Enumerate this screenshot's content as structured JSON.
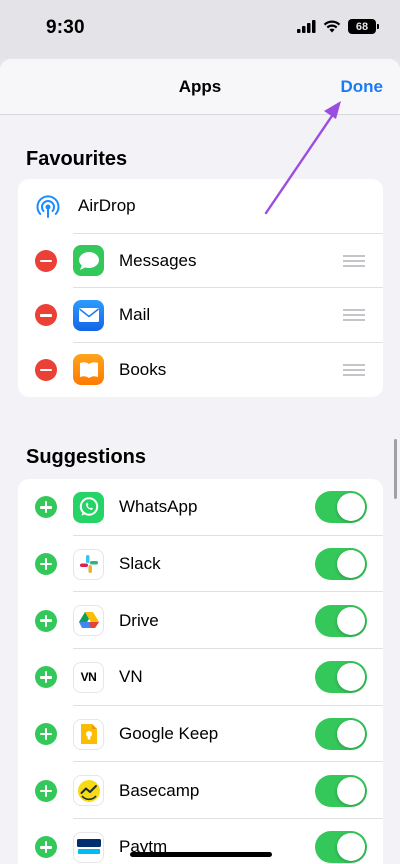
{
  "status_bar": {
    "time": "9:30",
    "battery": "68",
    "icons": [
      "cellular-signal-icon",
      "wifi-icon",
      "battery-icon"
    ]
  },
  "nav": {
    "title": "Apps",
    "done_label": "Done"
  },
  "favourites": {
    "header": "Favourites",
    "airdrop": {
      "label": "AirDrop",
      "icon": "airdrop-icon"
    },
    "items": [
      {
        "label": "Messages",
        "icon": "messages-icon",
        "color": "#34c759"
      },
      {
        "label": "Mail",
        "icon": "mail-icon",
        "color": "#1a8cff"
      },
      {
        "label": "Books",
        "icon": "books-icon",
        "color": "#ff8c00"
      }
    ]
  },
  "suggestions": {
    "header": "Suggestions",
    "items": [
      {
        "label": "WhatsApp",
        "icon": "whatsapp-icon",
        "enabled": true
      },
      {
        "label": "Slack",
        "icon": "slack-icon",
        "enabled": true
      },
      {
        "label": "Drive",
        "icon": "google-drive-icon",
        "enabled": true
      },
      {
        "label": "VN",
        "icon": "vn-icon",
        "icon_text": "VN",
        "enabled": true
      },
      {
        "label": "Google Keep",
        "icon": "google-keep-icon",
        "enabled": true
      },
      {
        "label": "Basecamp",
        "icon": "basecamp-icon",
        "enabled": true
      },
      {
        "label": "Paytm",
        "icon": "paytm-icon",
        "enabled": true
      }
    ]
  },
  "colors": {
    "accent": "#1a7cf5",
    "delete": "#eb4035",
    "add": "#34c759",
    "annotation_arrow": "#9b4de0"
  }
}
